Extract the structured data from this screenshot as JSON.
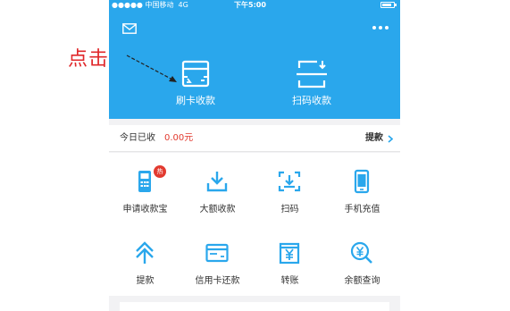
{
  "status_bar": {
    "carrier": "●●●●● 中国移动",
    "network": "4G",
    "time": "下午5:00",
    "battery_level": 0.8
  },
  "header": {
    "mail_icon": "mail-icon",
    "more_icon": "more-icon",
    "actions": [
      {
        "label": "刷卡收款",
        "icon": "card-swipe-icon"
      },
      {
        "label": "扫码收款",
        "icon": "scan-code-icon"
      }
    ]
  },
  "annotation": {
    "text": "点击",
    "color": "#e0282b"
  },
  "today": {
    "label": "今日已收",
    "amount": "0.00元",
    "withdraw": "提款"
  },
  "grid": {
    "items": [
      {
        "label": "申请收款宝",
        "icon": "pos-terminal-icon",
        "badge": "热"
      },
      {
        "label": "大额收款",
        "icon": "download-tray-icon"
      },
      {
        "label": "扫码",
        "icon": "scan-icon"
      },
      {
        "label": "手机充值",
        "icon": "phone-icon"
      },
      {
        "label": "提款",
        "icon": "arrow-up-icon"
      },
      {
        "label": "信用卡还款",
        "icon": "credit-card-icon"
      },
      {
        "label": "转账",
        "icon": "yen-transfer-icon"
      },
      {
        "label": "余额查询",
        "icon": "yen-search-icon"
      }
    ]
  },
  "colors": {
    "brand_blue": "#2aa7ec",
    "accent_red": "#e23a2f",
    "icon_blue": "#2aa7ec"
  }
}
